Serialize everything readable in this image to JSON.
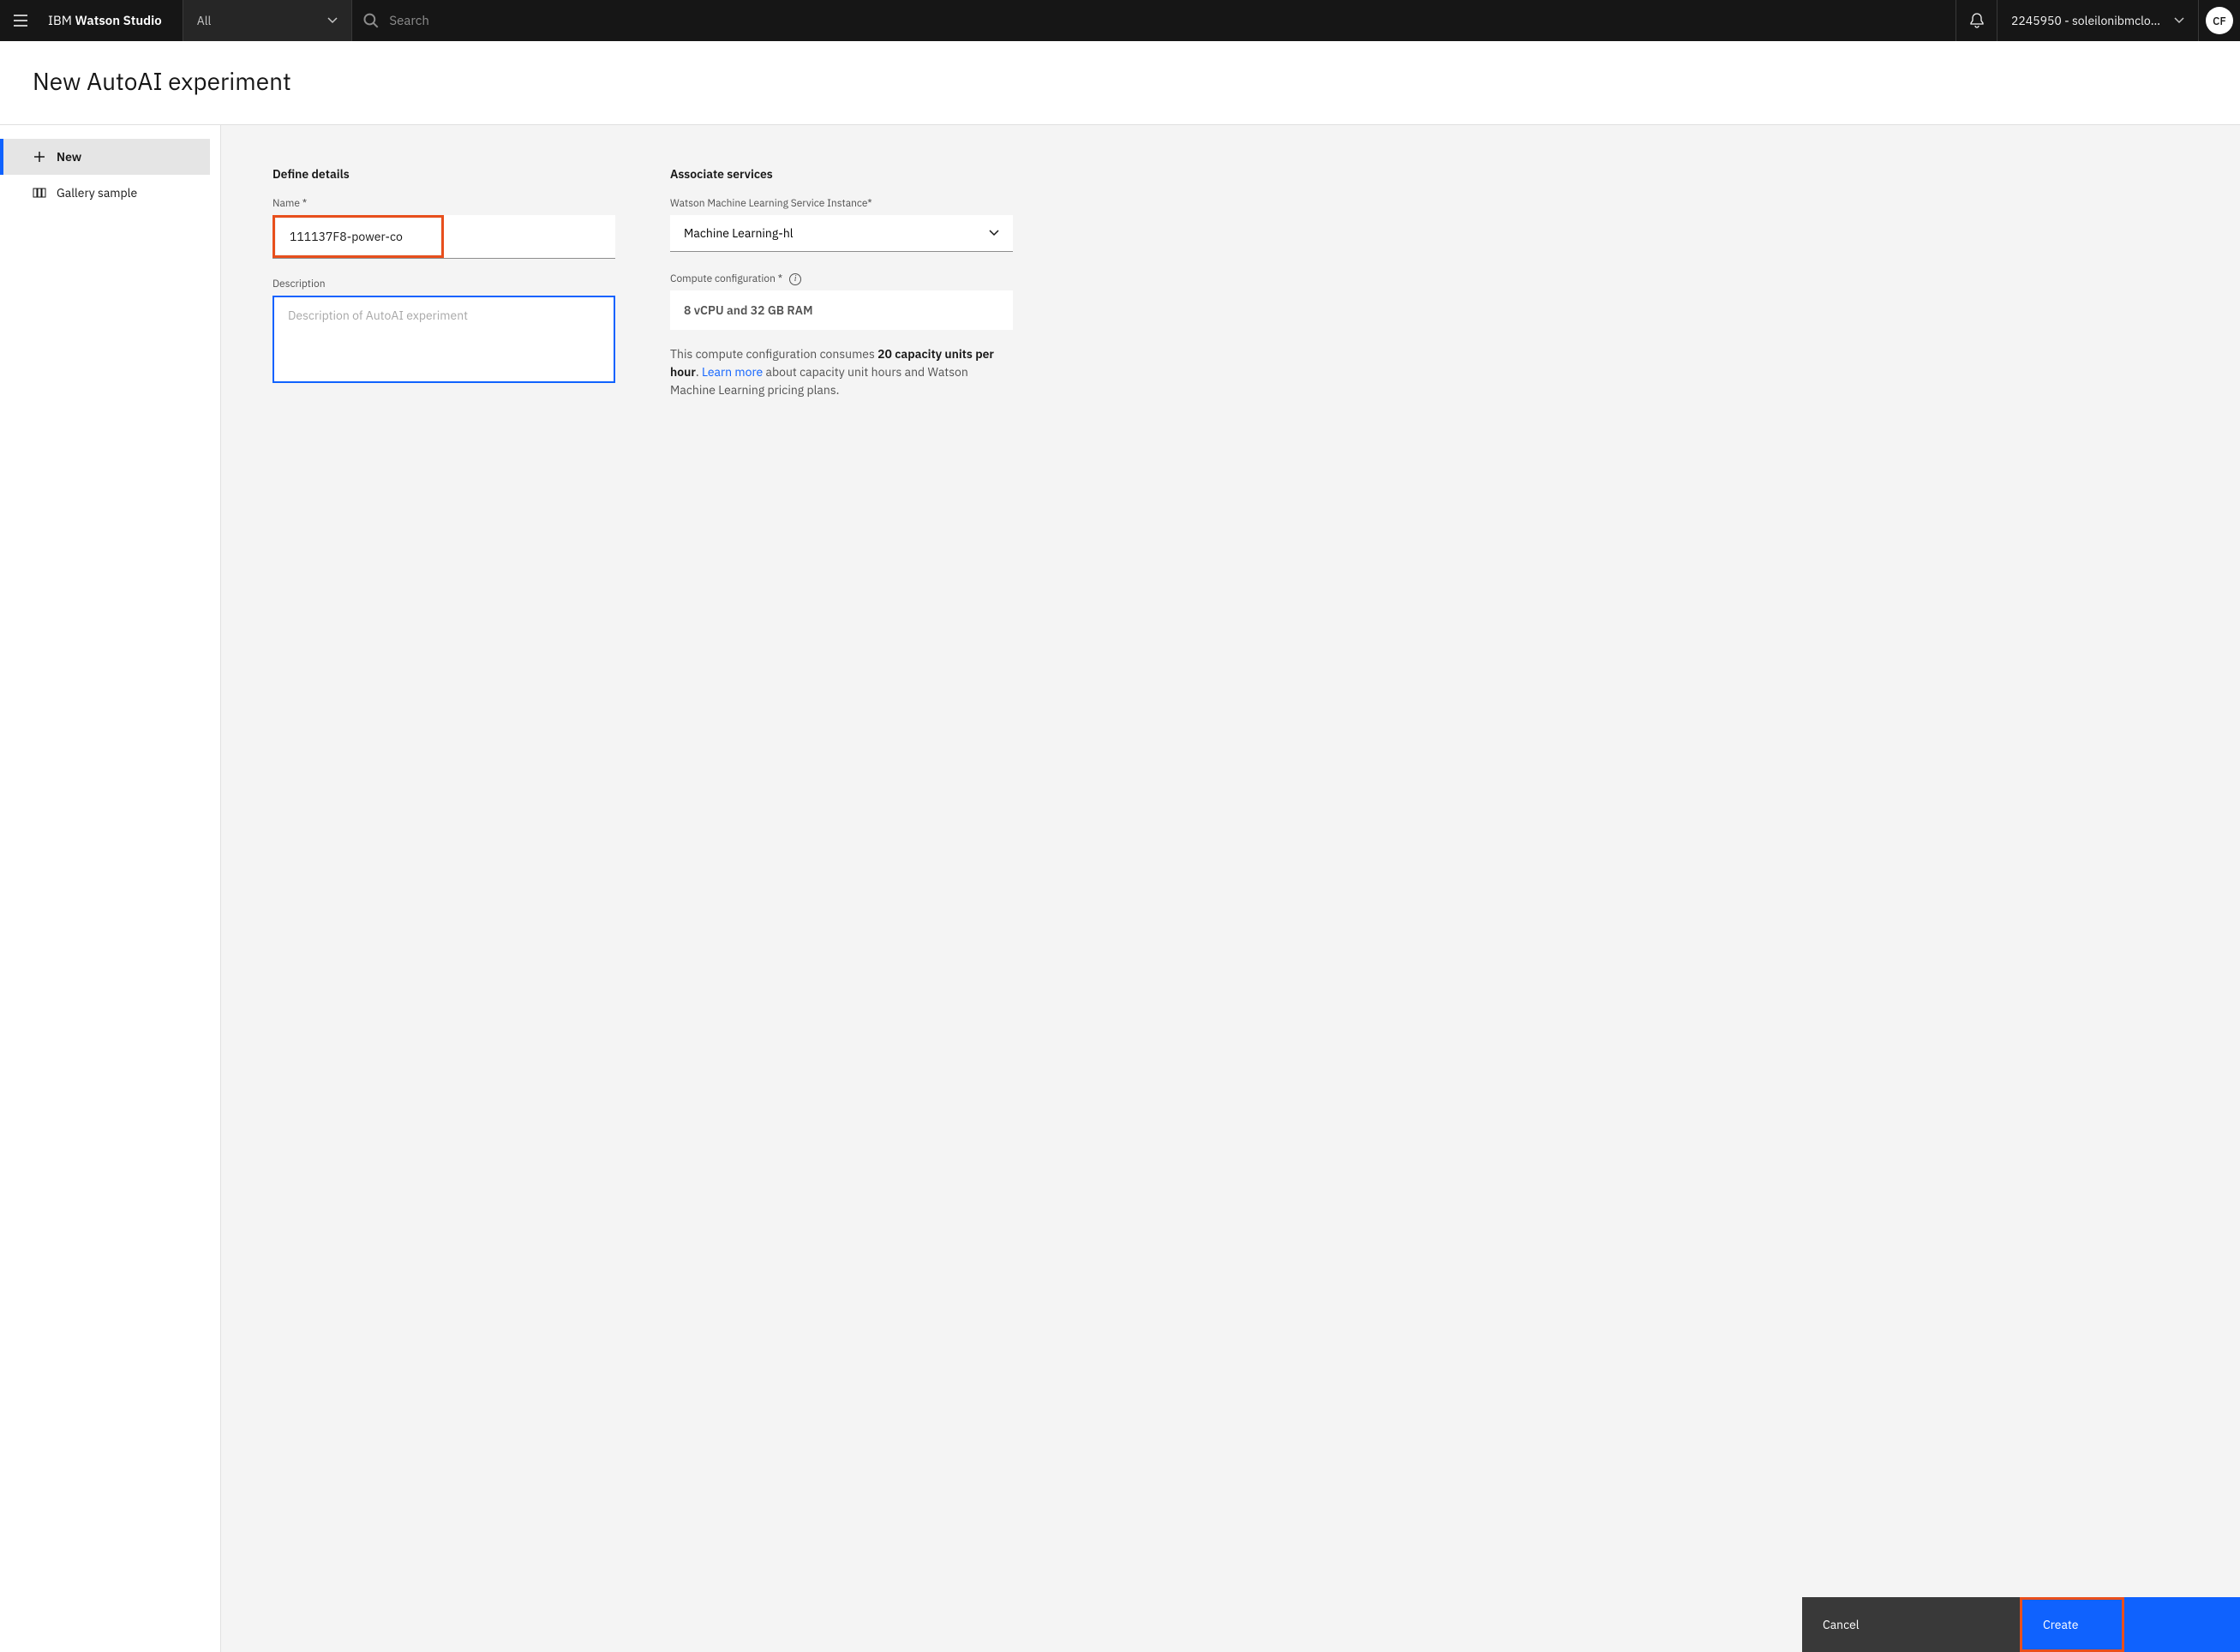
{
  "topbar": {
    "brand_prefix": "IBM ",
    "brand_bold": "Watson Studio",
    "scope_label": "All",
    "search_placeholder": "Search",
    "account_label": "2245950 - soleilonibmclou…",
    "avatar_initials": "CF"
  },
  "page": {
    "title": "New AutoAI experiment"
  },
  "sidebar": {
    "items": [
      {
        "label": "New",
        "icon": "plus"
      },
      {
        "label": "Gallery sample",
        "icon": "gallery"
      }
    ]
  },
  "details": {
    "section_title": "Define details",
    "name_label": "Name *",
    "name_value": "111137F8-power-co",
    "description_label": "Description",
    "description_placeholder": "Description of AutoAI experiment"
  },
  "services": {
    "section_title": "Associate services",
    "wml_label": "Watson Machine Learning Service Instance*",
    "wml_value": "Machine Learning-hl",
    "compute_label": "Compute configuration *",
    "compute_value": "8 vCPU and 32 GB RAM",
    "help_pre": "This compute configuration consumes ",
    "help_bold": "20 capacity units per hour",
    "help_mid": ". ",
    "help_link": "Learn more",
    "help_post": " about capacity unit hours and Watson Machine Learning pricing plans."
  },
  "footer": {
    "cancel": "Cancel",
    "create": "Create"
  }
}
